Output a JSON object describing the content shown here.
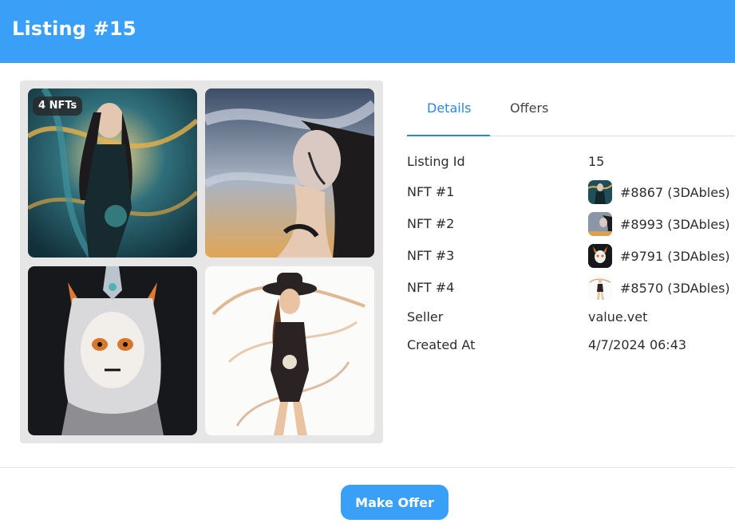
{
  "header": {
    "title": "Listing #15"
  },
  "gallery": {
    "count_badge": "4 NFTs"
  },
  "tabs": [
    {
      "label": "Details",
      "active": true
    },
    {
      "label": "Offers",
      "active": false
    }
  ],
  "details": {
    "listing_id": {
      "label": "Listing Id",
      "value": "15"
    },
    "nfts": [
      {
        "label": "NFT #1",
        "value": "#8867 (3DAbles)"
      },
      {
        "label": "NFT #2",
        "value": "#8993 (3DAbles)"
      },
      {
        "label": "NFT #3",
        "value": "#9791 (3DAbles)"
      },
      {
        "label": "NFT #4",
        "value": "#8570 (3DAbles)"
      }
    ],
    "seller": {
      "label": "Seller",
      "value": "value.vet"
    },
    "created_at": {
      "label": "Created At",
      "value": "4/7/2024 06:43"
    }
  },
  "actions": {
    "make_offer_label": "Make Offer"
  },
  "colors": {
    "header_bg": "#3aa0f7",
    "accent": "#2b86d9",
    "button_bg": "#3aa0f7"
  }
}
